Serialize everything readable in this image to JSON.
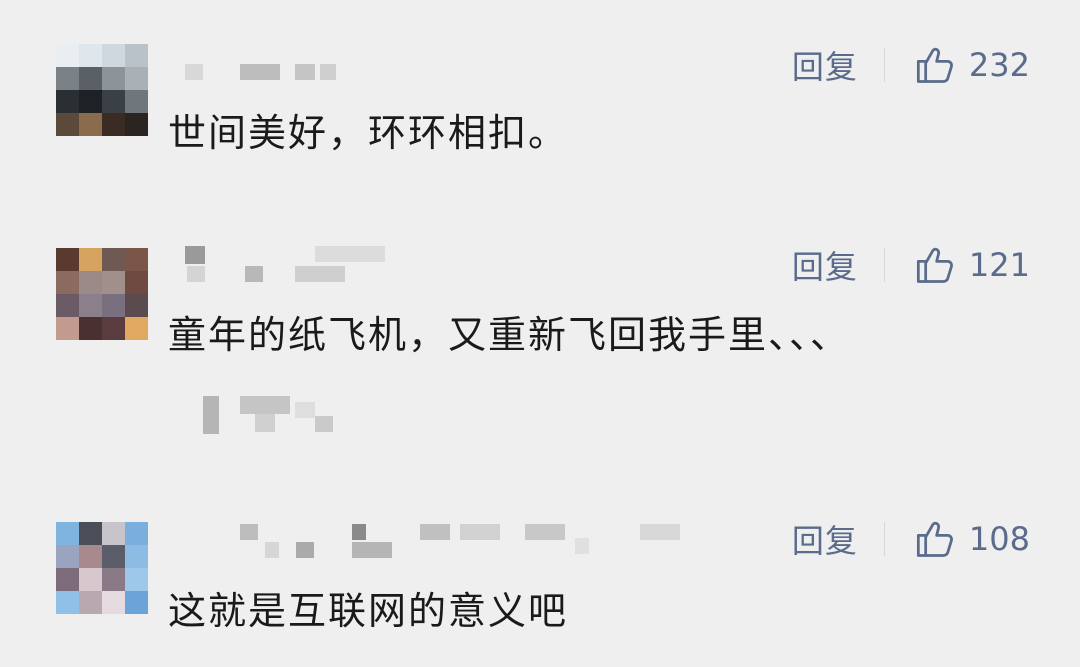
{
  "comments": [
    {
      "text": "世间美好，环环相扣。",
      "reply_label": "回复",
      "like_count": "232"
    },
    {
      "text": "童年的纸飞机，又重新飞回我手里、、、",
      "reply_label": "回复",
      "like_count": "121"
    },
    {
      "text": "这就是互联网的意义吧",
      "reply_label": "回复",
      "like_count": "108"
    }
  ],
  "colors": {
    "background": "#efefef",
    "action": "#5a6b8c",
    "text": "#1a1a1a"
  },
  "icons": {
    "like": "thumbs-up-icon"
  }
}
